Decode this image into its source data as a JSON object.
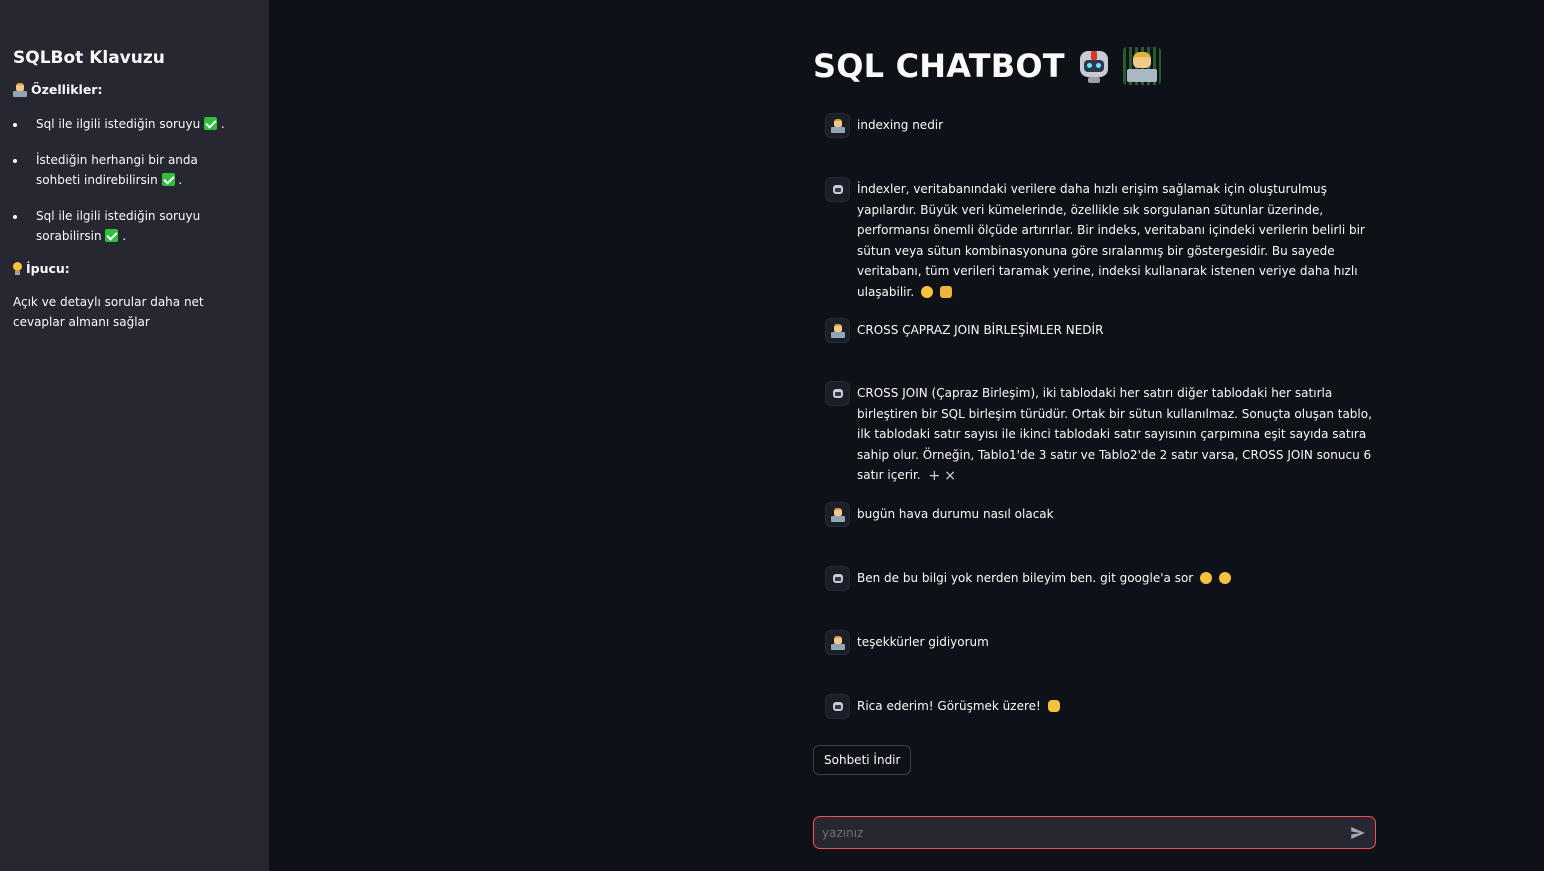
{
  "sidebar": {
    "title": "SQLBot Klavuzu",
    "features_heading": "Özellikler:",
    "features": [
      "Sql ile ilgili istediğin soruyu",
      "İstediğin herhangi bir anda sohbeti indirebilirsin",
      "Sql ile ilgili istediğin soruyu sorabilirsin"
    ],
    "tip_heading": "İpucu:",
    "tip_text": "Açık ve detaylı sorular daha net cevaplar almanı sağlar"
  },
  "main": {
    "title": "SQL CHATBOT",
    "messages": [
      {
        "role": "user",
        "text": "indexing nedir"
      },
      {
        "role": "assistant",
        "text": "İndexler, veritabanındaki verilere daha hızlı erişim sağlamak için oluşturulmuş yapılardır. Büyük veri kümelerinde, özellikle sık sorgulanan sütunlar üzerinde, performansı önemli ölçüde artırırlar. Bir indeks, veritabanı içindeki verilerin belirli bir sütun veya sütun kombinasyonuna göre sıralanmış bir göstergesidir. Bu sayede veritabanı, tüm verileri taramak yerine, indeksi kullanarak istenen veriye daha hızlı ulaşabilir."
      },
      {
        "role": "user",
        "text": "CROSS ÇAPRAZ JOIN BİRLEŞİMLER NEDİR"
      },
      {
        "role": "assistant",
        "text": "CROSS JOIN (Çapraz Birleşim), iki tablodaki her satırı diğer tablodaki her satırla birleştiren bir SQL birleşim türüdür. Ortak bir sütun kullanılmaz. Sonuçta oluşan tablo, ilk tablodaki satır sayısı ile ikinci tablodaki satır sayısının çarpımına eşit sayıda satıra sahip olur. Örneğin, Tablo1'de 3 satır ve Tablo2'de 2 satır varsa, CROSS JOIN sonucu 6 satır içerir."
      },
      {
        "role": "user",
        "text": "bugün hava durumu nasıl olacak"
      },
      {
        "role": "assistant",
        "text": "Ben de bu bilgi yok nerden bileyim ben. git google'a sor"
      },
      {
        "role": "user",
        "text": "teşekkürler gidiyorum"
      },
      {
        "role": "assistant",
        "text": "Rica ederim! Görüşmek üzere!"
      }
    ],
    "download_button": "Sohbeti İndir",
    "input_placeholder": "yazınız"
  },
  "icons": {
    "user_avatar": "technologist-icon",
    "assistant_avatar": "robot-icon",
    "send": "send-icon",
    "check": "check-mark-icon",
    "tip": "light-bulb-icon"
  },
  "colors": {
    "background": "#0e1117",
    "sidebar": "#262730",
    "input_border": "#ff4b4b",
    "check": "#2fbf3a"
  }
}
